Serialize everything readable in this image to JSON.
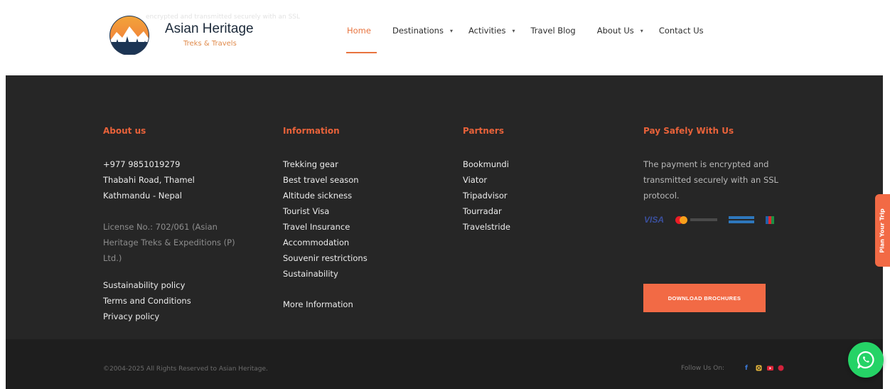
{
  "header": {
    "faded_text": "encrypted and transmitted securely with an SSL",
    "brand_name": "Asian Heritage",
    "brand_tagline": "Treks & Travels",
    "nav": [
      {
        "label": "Home",
        "active": true,
        "dropdown": false
      },
      {
        "label": "Destinations",
        "active": false,
        "dropdown": true
      },
      {
        "label": "Activities",
        "active": false,
        "dropdown": true
      },
      {
        "label": "Travel Blog",
        "active": false,
        "dropdown": false
      },
      {
        "label": "About Us",
        "active": false,
        "dropdown": true
      },
      {
        "label": "Contact Us",
        "active": false,
        "dropdown": false
      }
    ]
  },
  "footer": {
    "about": {
      "title": "About us",
      "phone": "+977 9851019279",
      "address_line1": "Thabahi Road, Thamel",
      "address_line2": "Kathmandu - Nepal",
      "license_line1": "License No.: 702/061 (Asian",
      "license_line2": "Heritage Treks & Expeditions (P)",
      "license_line3": "Ltd.)",
      "links": [
        "Sustainability policy",
        "Terms and Conditions",
        "Privacy policy"
      ]
    },
    "information": {
      "title": "Information",
      "links": [
        "Trekking gear",
        "Best travel season",
        "Altitude sickness",
        "Tourist Visa",
        "Travel Insurance",
        "Accommodation",
        "Souvenir restrictions",
        "Sustainability"
      ],
      "more": "More Information"
    },
    "partners": {
      "title": "Partners",
      "links": [
        "Bookmundi",
        "Viator",
        "Tripadvisor",
        "Tourradar",
        "Travelstride"
      ]
    },
    "pay": {
      "title": "Pay Safely With Us",
      "text_line1": "The payment is encrypted and",
      "text_line2": "transmitted securely with an SSL",
      "text_line3": "protocol.",
      "cards": [
        "VISA",
        "mastercard",
        "amex",
        "jcb"
      ],
      "download_button": "DOWNLOAD BROCHURES"
    }
  },
  "bottom": {
    "copyright": "©2004-2025 All Rights Reserved to Asian Heritage.",
    "follow_label": "Follow Us On:",
    "social_icons": [
      "facebook-icon",
      "instagram-icon",
      "youtube-icon",
      "pinterest-icon"
    ]
  },
  "floating": {
    "plan_tab": "Plan Your Trip"
  },
  "colors": {
    "accent": "#e8623a",
    "button": "#f26a45",
    "footer_bg": "#262626",
    "bottom_bg": "#1e1e1e",
    "whatsapp": "#25d366"
  }
}
